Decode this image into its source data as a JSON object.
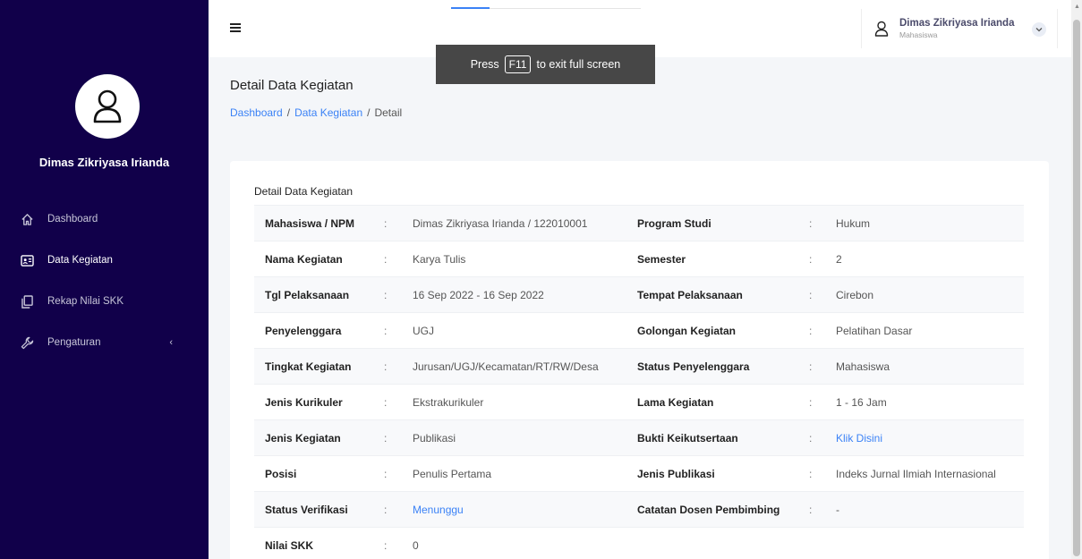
{
  "sidebar": {
    "user_name": "Dimas Zikriyasa Irianda",
    "menu": [
      {
        "label": "Dashboard",
        "icon": "home-icon"
      },
      {
        "label": "Data Kegiatan",
        "icon": "id-card-icon"
      },
      {
        "label": "Rekap Nilai SKK",
        "icon": "copy-icon"
      },
      {
        "label": "Pengaturan",
        "icon": "wrench-icon"
      }
    ]
  },
  "topbar": {
    "user_name": "Dimas Zikriyasa Irianda",
    "user_role": "Mahasiswa"
  },
  "f11_notice": {
    "prefix": "Press",
    "key": "F11",
    "suffix": "to exit full screen"
  },
  "page": {
    "title": "Detail Data Kegiatan",
    "breadcrumb": [
      "Dashboard",
      "Data Kegiatan",
      "Detail"
    ],
    "breadcrumb_sep": "/"
  },
  "card": {
    "title": "Detail Data Kegiatan",
    "colon": ":",
    "rows": [
      {
        "label1": "Mahasiswa / NPM",
        "value1": "Dimas Zikriyasa Irianda / 122010001",
        "label2": "Program Studi",
        "value2": "Hukum"
      },
      {
        "label1": "Nama Kegiatan",
        "value1": "Karya Tulis",
        "label2": "Semester",
        "value2": "2"
      },
      {
        "label1": "Tgl Pelaksanaan",
        "value1": "16 Sep 2022 - 16 Sep 2022",
        "label2": "Tempat Pelaksanaan",
        "value2": "Cirebon"
      },
      {
        "label1": "Penyelenggara",
        "value1": "UGJ",
        "label2": "Golongan Kegiatan",
        "value2": "Pelatihan Dasar"
      },
      {
        "label1": "Tingkat Kegiatan",
        "value1": "Jurusan/UGJ/Kecamatan/RT/RW/Desa",
        "label2": "Status Penyelenggara",
        "value2": "Mahasiswa"
      },
      {
        "label1": "Jenis Kurikuler",
        "value1": "Ekstrakurikuler",
        "label2": "Lama Kegiatan",
        "value2": "1 - 16 Jam"
      },
      {
        "label1": "Jenis Kegiatan",
        "value1": "Publikasi",
        "label2": "Bukti Keikutsertaan",
        "value2": "Klik Disini"
      },
      {
        "label1": "Posisi",
        "value1": "Penulis Pertama",
        "label2": "Jenis Publikasi",
        "value2": "Indeks Jurnal Ilmiah Internasional"
      },
      {
        "label1": "Status Verifikasi",
        "value1": "Menunggu",
        "label2": "Catatan Dosen Pembimbing",
        "value2": "-"
      },
      {
        "label1": "Nilai SKK",
        "value1": "0"
      }
    ]
  },
  "colors": {
    "sidebar_bg": "#11004a",
    "link": "#3b82f6"
  }
}
